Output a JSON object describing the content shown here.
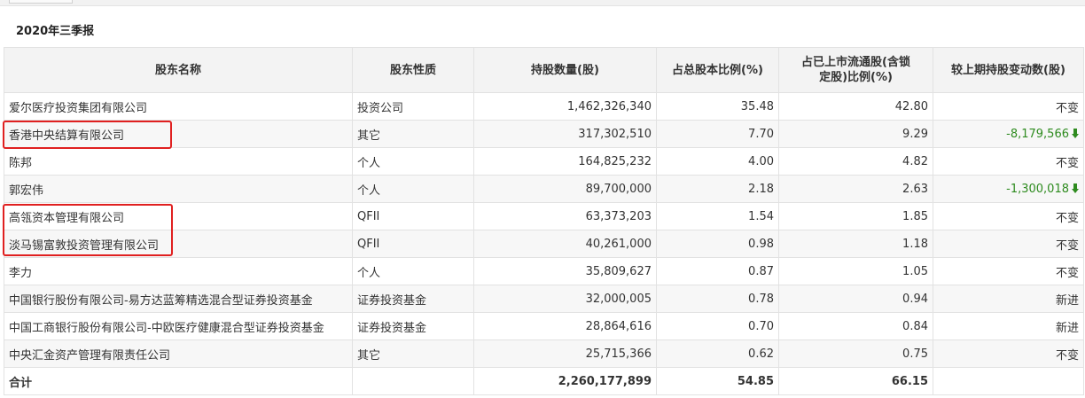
{
  "section_title": "2020年三季报",
  "columns": [
    "股东名称",
    "股东性质",
    "持股数量(股)",
    "占总股本比例(%)",
    "占已上市流通股(含锁定股)比例(%)",
    "较上期持股变动数(股)"
  ],
  "rows": [
    {
      "name": "爱尔医疗投资集团有限公司",
      "type": "投资公司",
      "shares": "1,462,326,340",
      "pct_total": "35.48",
      "pct_float": "42.80",
      "change": "不变",
      "direction": "none"
    },
    {
      "name": "香港中央结算有限公司",
      "type": "其它",
      "shares": "317,302,510",
      "pct_total": "7.70",
      "pct_float": "9.29",
      "change": "-8,179,566",
      "direction": "down"
    },
    {
      "name": "陈邦",
      "type": "个人",
      "shares": "164,825,232",
      "pct_total": "4.00",
      "pct_float": "4.82",
      "change": "不变",
      "direction": "none"
    },
    {
      "name": "郭宏伟",
      "type": "个人",
      "shares": "89,700,000",
      "pct_total": "2.18",
      "pct_float": "2.63",
      "change": "-1,300,018",
      "direction": "down"
    },
    {
      "name": "高瓴资本管理有限公司",
      "type": "QFII",
      "shares": "63,373,203",
      "pct_total": "1.54",
      "pct_float": "1.85",
      "change": "不变",
      "direction": "none"
    },
    {
      "name": "淡马锡富敦投资管理有限公司",
      "type": "QFII",
      "shares": "40,261,000",
      "pct_total": "0.98",
      "pct_float": "1.18",
      "change": "不变",
      "direction": "none"
    },
    {
      "name": "李力",
      "type": "个人",
      "shares": "35,809,627",
      "pct_total": "0.87",
      "pct_float": "1.05",
      "change": "不变",
      "direction": "none"
    },
    {
      "name": "中国银行股份有限公司-易方达蓝筹精选混合型证券投资基金",
      "type": "证券投资基金",
      "shares": "32,000,005",
      "pct_total": "0.78",
      "pct_float": "0.94",
      "change": "新进",
      "direction": "none"
    },
    {
      "name": "中国工商银行股份有限公司-中欧医疗健康混合型证券投资基金",
      "type": "证券投资基金",
      "shares": "28,864,616",
      "pct_total": "0.70",
      "pct_float": "0.84",
      "change": "新进",
      "direction": "none"
    },
    {
      "name": "中央汇金资产管理有限责任公司",
      "type": "其它",
      "shares": "25,715,366",
      "pct_total": "0.62",
      "pct_float": "0.75",
      "change": "不变",
      "direction": "none"
    }
  ],
  "total": {
    "label": "合计",
    "shares": "2,260,177,899",
    "pct_total": "54.85",
    "pct_float": "66.15"
  },
  "colors": {
    "header_bg": "#f3f3f3",
    "decrease": "#2e8b1f",
    "highlight_box": "#e02020"
  },
  "icons": {
    "decrease": "down-arrow-icon"
  }
}
